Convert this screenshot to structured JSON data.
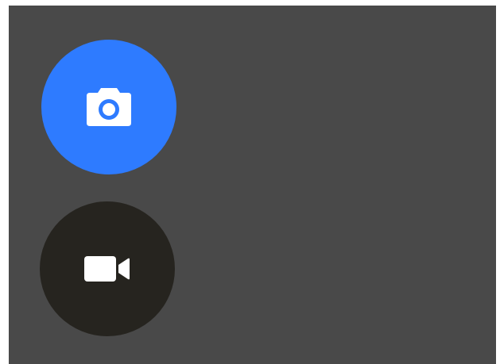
{
  "capture_modes": [
    {
      "id": "photo",
      "icon": "camera-icon",
      "state": "selected",
      "bg_color": "#2e7bff",
      "icon_color": "#ffffff"
    },
    {
      "id": "video",
      "icon": "video-camera-icon",
      "state": "unselected",
      "bg_color": "#26241f",
      "icon_color": "#ffffff"
    }
  ],
  "colors": {
    "panel_background": "#494949",
    "page_background": "#ffffff"
  }
}
